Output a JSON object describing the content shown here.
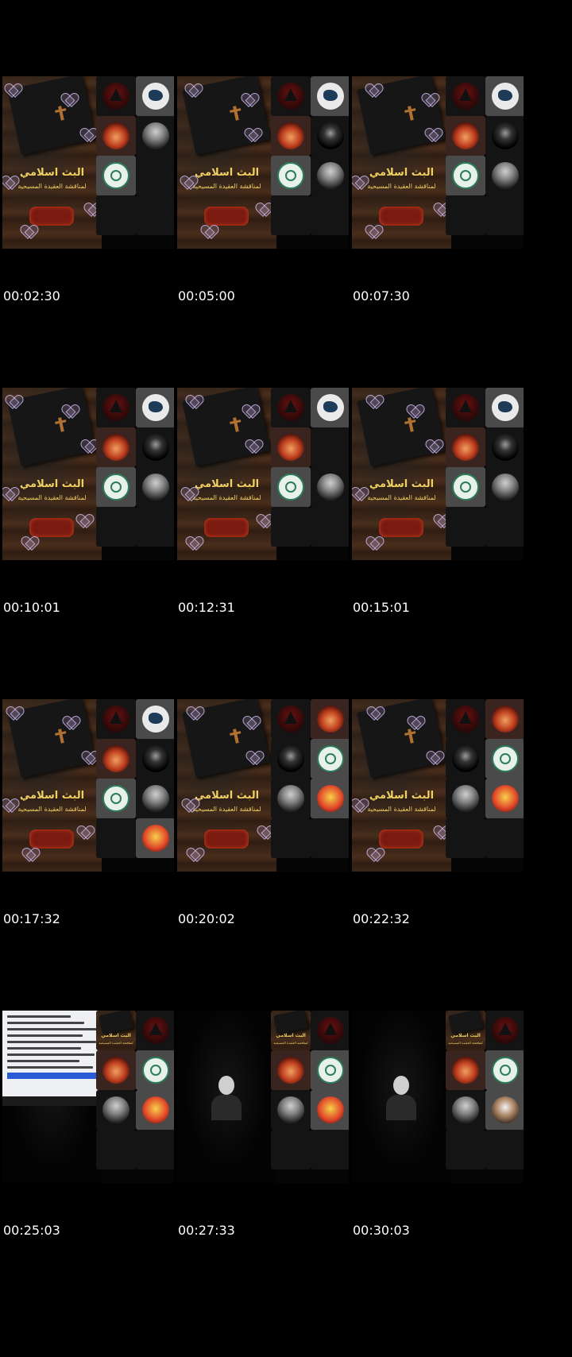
{
  "stream_overlay": {
    "title": "البث اسلامي",
    "subtitle": "لمناقشة العقيدة المسيحية"
  },
  "frames": [
    {
      "timestamp": "00:02:30",
      "stream": "overlay",
      "tiles": [
        "arrow",
        "hand",
        "fire",
        "person",
        "seal",
        "empty",
        "empty",
        "empty"
      ]
    },
    {
      "timestamp": "00:05:00",
      "stream": "overlay",
      "tiles": [
        "arrow",
        "hand",
        "fire",
        "dark",
        "seal",
        "person",
        "empty",
        "empty"
      ]
    },
    {
      "timestamp": "00:07:30",
      "stream": "overlay",
      "tiles": [
        "arrow",
        "hand",
        "fire",
        "dark",
        "seal",
        "person",
        "empty",
        "empty"
      ]
    },
    {
      "timestamp": "00:10:01",
      "stream": "overlay",
      "tiles": [
        "arrow",
        "hand",
        "fire",
        "dark",
        "seal",
        "person",
        "empty",
        "empty"
      ]
    },
    {
      "timestamp": "00:12:31",
      "stream": "overlay",
      "tiles": [
        "arrow",
        "hand",
        "fire",
        "empty",
        "seal",
        "person",
        "empty",
        "empty"
      ]
    },
    {
      "timestamp": "00:15:01",
      "stream": "overlay",
      "tiles": [
        "arrow",
        "hand",
        "fire",
        "dark",
        "seal",
        "person",
        "empty",
        "empty"
      ]
    },
    {
      "timestamp": "00:17:32",
      "stream": "overlay",
      "tiles": [
        "arrow",
        "hand",
        "fire",
        "dark",
        "seal",
        "person",
        "empty",
        "cartoon"
      ]
    },
    {
      "timestamp": "00:20:02",
      "stream": "overlay",
      "tiles": [
        "arrow",
        "fire",
        "dark",
        "seal",
        "person",
        "cartoon",
        "empty",
        "empty"
      ]
    },
    {
      "timestamp": "00:22:32",
      "stream": "overlay",
      "tiles": [
        "arrow",
        "fire",
        "dark",
        "seal",
        "person",
        "cartoon",
        "empty",
        "empty"
      ]
    },
    {
      "timestamp": "00:25:03",
      "stream": "document",
      "tiles": [
        "overlay",
        "arrow",
        "fire",
        "seal",
        "person",
        "cartoon",
        "empty",
        "empty"
      ]
    },
    {
      "timestamp": "00:27:33",
      "stream": "presenter",
      "tiles": [
        "overlay",
        "arrow",
        "fire",
        "seal",
        "person",
        "cartoon",
        "empty",
        "empty"
      ]
    },
    {
      "timestamp": "00:30:03",
      "stream": "presenter",
      "tiles": [
        "overlay",
        "arrow",
        "fire",
        "seal",
        "person",
        "turban",
        "empty",
        "empty"
      ]
    }
  ],
  "colors": {
    "background": "#000000",
    "overlay_text": "#f0d060",
    "wood": "#3a2416"
  }
}
